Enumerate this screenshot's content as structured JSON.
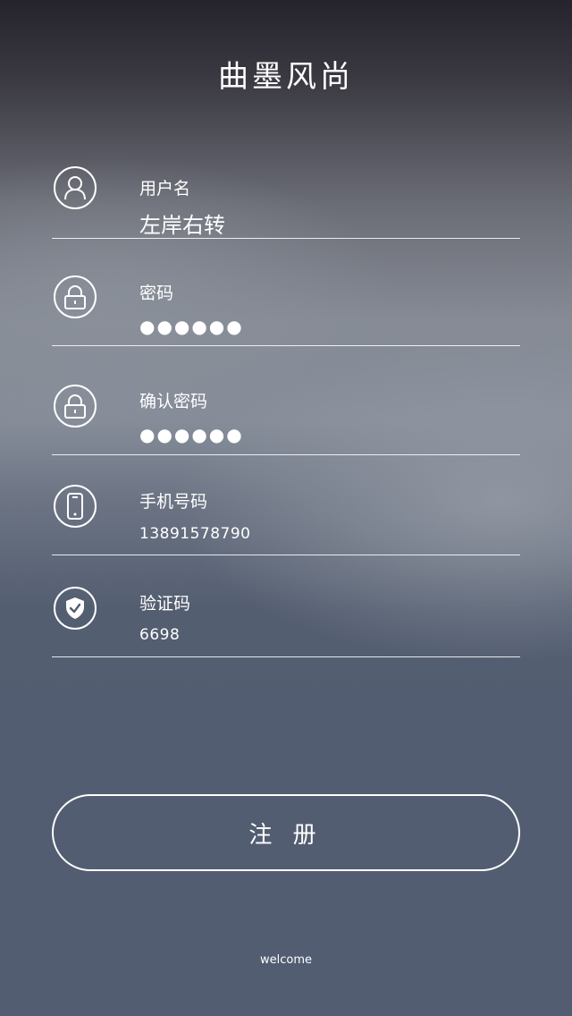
{
  "app": {
    "logo_text": "曲墨风尚",
    "footer_text": "welcome"
  },
  "form": {
    "username": {
      "label": "用户名",
      "value": "左岸右转",
      "icon": "user-icon"
    },
    "password": {
      "label": "密码",
      "value": "●●●●●●",
      "icon": "lock-icon"
    },
    "confirm_password": {
      "label": "确认密码",
      "value": "●●●●●●",
      "icon": "lock-icon"
    },
    "phone": {
      "label": "手机号码",
      "value": "13891578790",
      "icon": "phone-icon"
    },
    "verification": {
      "label": "验证码",
      "value": "6698",
      "icon": "shield-check-icon"
    }
  },
  "actions": {
    "register_label": "注 册"
  }
}
